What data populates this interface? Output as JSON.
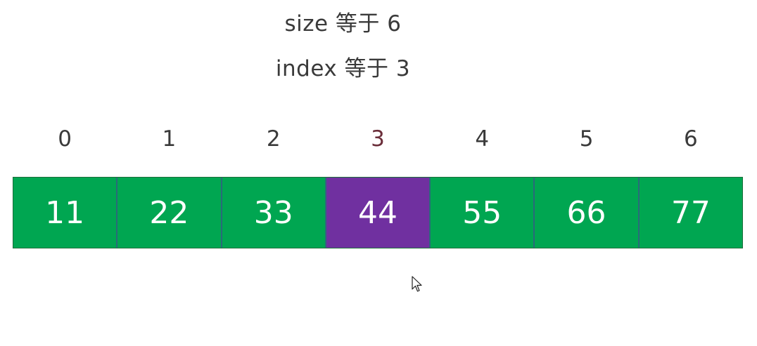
{
  "header": {
    "size_line": "size 等于 6",
    "index_line": "index 等于 3"
  },
  "array": {
    "indices": [
      "0",
      "1",
      "2",
      "3",
      "4",
      "5",
      "6"
    ],
    "values": [
      "11",
      "22",
      "33",
      "44",
      "55",
      "66",
      "77"
    ],
    "highlight_index": 3
  },
  "colors": {
    "cell_default": "#00a651",
    "cell_highlight": "#7030a0",
    "index_highlight": "#6b2e3a",
    "text": "#3a3a3a"
  },
  "icons": {
    "cursor": "mouse-pointer-icon"
  }
}
